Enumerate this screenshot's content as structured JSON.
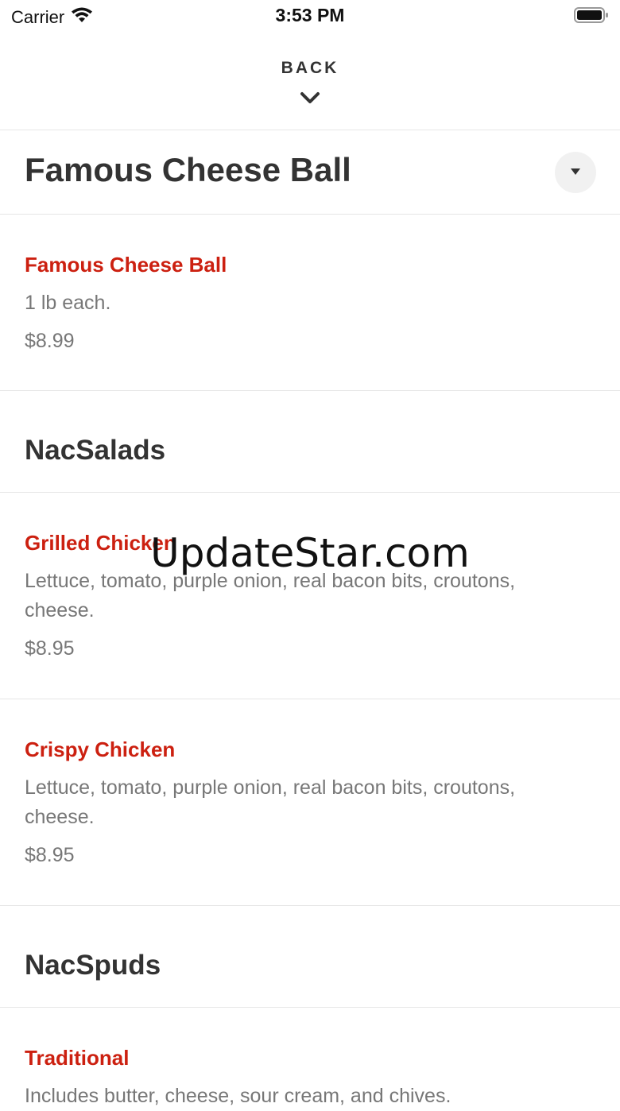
{
  "status_bar": {
    "carrier": "Carrier",
    "time": "3:53 PM"
  },
  "nav": {
    "back_label": "BACK"
  },
  "category": {
    "title": "Famous Cheese Ball"
  },
  "items": [
    {
      "name": "Famous Cheese Ball",
      "description": "1 lb each.",
      "price": "$8.99"
    }
  ],
  "sections": [
    {
      "title": "NacSalads",
      "items": [
        {
          "name": "Grilled Chicken",
          "description": "Lettuce, tomato, purple onion, real bacon bits, croutons, cheese.",
          "price": "$8.95"
        },
        {
          "name": "Crispy Chicken",
          "description": "Lettuce, tomato, purple onion, real bacon bits, croutons, cheese.",
          "price": "$8.95"
        }
      ]
    },
    {
      "title": "NacSpuds",
      "items": [
        {
          "name": "Traditional",
          "description": "Includes butter, cheese, sour cream, and chives."
        }
      ]
    }
  ],
  "watermark": "UpdateStar.com",
  "colors": {
    "accent": "#cc2010",
    "title": "#333333",
    "muted": "#777777",
    "divider": "#e6e6e6"
  }
}
